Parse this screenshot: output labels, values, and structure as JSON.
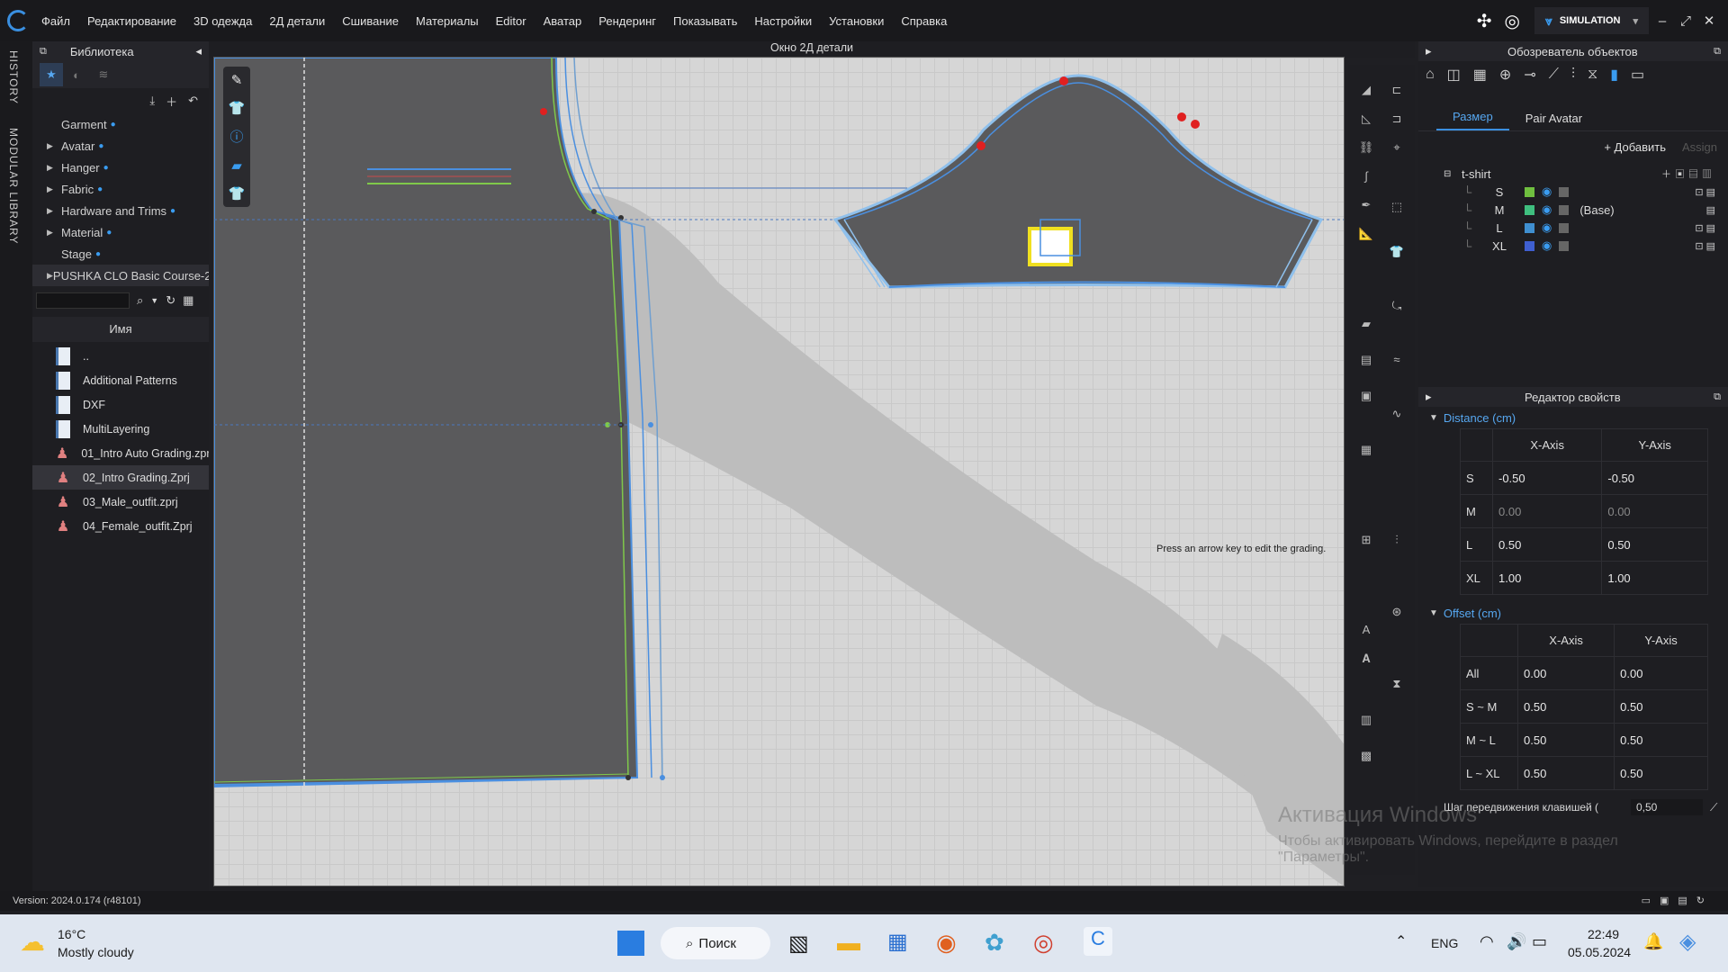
{
  "menu": {
    "items": [
      "Файл",
      "Редактирование",
      "3D одежда",
      "2Д детали",
      "Сшивание",
      "Материалы",
      "Editor",
      "Аватар",
      "Рендеринг",
      "Показывать",
      "Настройки",
      "Установки",
      "Справка"
    ],
    "simulation": "SIMULATION"
  },
  "side_tabs": {
    "history": "HISTORY",
    "modular": "MODULAR LIBRARY"
  },
  "library": {
    "title": "Библиотека",
    "tree": [
      {
        "label": "Garment",
        "expandable": false
      },
      {
        "label": "Avatar",
        "expandable": true
      },
      {
        "label": "Hanger",
        "expandable": true
      },
      {
        "label": "Fabric",
        "expandable": true
      },
      {
        "label": "Hardware and Trims",
        "expandable": true
      },
      {
        "label": "Material",
        "expandable": true
      },
      {
        "label": "Stage",
        "expandable": false
      },
      {
        "label": "PUSHKA CLO Basic Course-2",
        "expandable": true
      }
    ],
    "column_header": "Имя",
    "files": [
      {
        "name": "..",
        "type": "folder"
      },
      {
        "name": "Additional Patterns",
        "type": "folder"
      },
      {
        "name": "DXF",
        "type": "folder"
      },
      {
        "name": "MultiLayering",
        "type": "folder"
      },
      {
        "name": "01_Intro Auto Grading.zprj",
        "type": "avatar"
      },
      {
        "name": "02_Intro Grading.Zprj",
        "type": "avatar",
        "selected": true
      },
      {
        "name": "03_Male_outfit.zprj",
        "type": "avatar"
      },
      {
        "name": "04_Female_outfit.Zprj",
        "type": "avatar"
      }
    ]
  },
  "canvas": {
    "title": "Окно 2Д детали",
    "hint": "Press an arrow key to edit the grading."
  },
  "explorer": {
    "title": "Обозреватель объектов",
    "tabs": [
      "Размер",
      "Pair Avatar"
    ],
    "add_label": "+ Добавить",
    "assign_label": "Assign",
    "root": "t-shirt",
    "sizes": [
      {
        "name": "S",
        "color": "#6fbf3f",
        "base": false
      },
      {
        "name": "M",
        "color": "#3fbf7f",
        "base": true,
        "base_label": "(Base)"
      },
      {
        "name": "L",
        "color": "#3f8fd0",
        "base": false
      },
      {
        "name": "XL",
        "color": "#3f5fd0",
        "base": false
      }
    ]
  },
  "props": {
    "title": "Редактор свойств",
    "distance": {
      "title": "Distance",
      "unit": "(cm)",
      "cols": [
        "X-Axis",
        "Y-Axis"
      ],
      "rows": [
        {
          "label": "S",
          "x": "-0.50",
          "y": "-0.50",
          "dim": false
        },
        {
          "label": "M",
          "x": "0.00",
          "y": "0.00",
          "dim": true
        },
        {
          "label": "L",
          "x": "0.50",
          "y": "0.50",
          "dim": false
        },
        {
          "label": "XL",
          "x": "1.00",
          "y": "1.00",
          "dim": false
        }
      ]
    },
    "offset": {
      "title": "Offset",
      "unit": "(cm)",
      "cols": [
        "X-Axis",
        "Y-Axis"
      ],
      "rows": [
        {
          "label": "All",
          "x": "0.00",
          "y": "0.00"
        },
        {
          "label": "S ~ M",
          "x": "0.50",
          "y": "0.50"
        },
        {
          "label": "M ~ L",
          "x": "0.50",
          "y": "0.50"
        },
        {
          "label": "L ~ XL",
          "x": "0.50",
          "y": "0.50"
        }
      ]
    },
    "step_label": "Шаг передвижения клавишей (",
    "step_value": "0,50"
  },
  "status": {
    "version": "Version: 2024.0.174 (r48101)"
  },
  "watermark": {
    "line1": "Активация Windows",
    "line2": "Чтобы активировать Windows, перейдите в раздел",
    "line3": "\"Параметры\"."
  },
  "taskbar": {
    "temp": "16°C",
    "weather": "Mostly cloudy",
    "search": "Поиск",
    "lang": "ENG",
    "time": "22:49",
    "date": "05.05.2024"
  }
}
